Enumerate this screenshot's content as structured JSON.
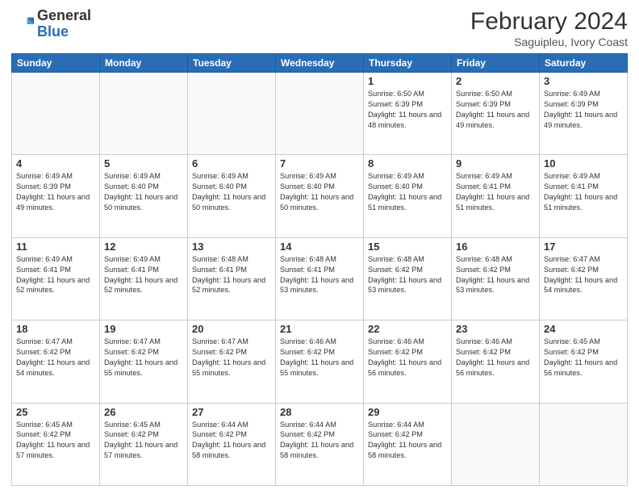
{
  "header": {
    "logo_general": "General",
    "logo_blue": "Blue",
    "month_title": "February 2024",
    "location": "Saguipleu, Ivory Coast"
  },
  "weekdays": [
    "Sunday",
    "Monday",
    "Tuesday",
    "Wednesday",
    "Thursday",
    "Friday",
    "Saturday"
  ],
  "weeks": [
    [
      {
        "day": "",
        "info": ""
      },
      {
        "day": "",
        "info": ""
      },
      {
        "day": "",
        "info": ""
      },
      {
        "day": "",
        "info": ""
      },
      {
        "day": "1",
        "info": "Sunrise: 6:50 AM\nSunset: 6:39 PM\nDaylight: 11 hours and 48 minutes."
      },
      {
        "day": "2",
        "info": "Sunrise: 6:50 AM\nSunset: 6:39 PM\nDaylight: 11 hours and 49 minutes."
      },
      {
        "day": "3",
        "info": "Sunrise: 6:49 AM\nSunset: 6:39 PM\nDaylight: 11 hours and 49 minutes."
      }
    ],
    [
      {
        "day": "4",
        "info": "Sunrise: 6:49 AM\nSunset: 6:39 PM\nDaylight: 11 hours and 49 minutes."
      },
      {
        "day": "5",
        "info": "Sunrise: 6:49 AM\nSunset: 6:40 PM\nDaylight: 11 hours and 50 minutes."
      },
      {
        "day": "6",
        "info": "Sunrise: 6:49 AM\nSunset: 6:40 PM\nDaylight: 11 hours and 50 minutes."
      },
      {
        "day": "7",
        "info": "Sunrise: 6:49 AM\nSunset: 6:40 PM\nDaylight: 11 hours and 50 minutes."
      },
      {
        "day": "8",
        "info": "Sunrise: 6:49 AM\nSunset: 6:40 PM\nDaylight: 11 hours and 51 minutes."
      },
      {
        "day": "9",
        "info": "Sunrise: 6:49 AM\nSunset: 6:41 PM\nDaylight: 11 hours and 51 minutes."
      },
      {
        "day": "10",
        "info": "Sunrise: 6:49 AM\nSunset: 6:41 PM\nDaylight: 11 hours and 51 minutes."
      }
    ],
    [
      {
        "day": "11",
        "info": "Sunrise: 6:49 AM\nSunset: 6:41 PM\nDaylight: 11 hours and 52 minutes."
      },
      {
        "day": "12",
        "info": "Sunrise: 6:49 AM\nSunset: 6:41 PM\nDaylight: 11 hours and 52 minutes."
      },
      {
        "day": "13",
        "info": "Sunrise: 6:48 AM\nSunset: 6:41 PM\nDaylight: 11 hours and 52 minutes."
      },
      {
        "day": "14",
        "info": "Sunrise: 6:48 AM\nSunset: 6:41 PM\nDaylight: 11 hours and 53 minutes."
      },
      {
        "day": "15",
        "info": "Sunrise: 6:48 AM\nSunset: 6:42 PM\nDaylight: 11 hours and 53 minutes."
      },
      {
        "day": "16",
        "info": "Sunrise: 6:48 AM\nSunset: 6:42 PM\nDaylight: 11 hours and 53 minutes."
      },
      {
        "day": "17",
        "info": "Sunrise: 6:47 AM\nSunset: 6:42 PM\nDaylight: 11 hours and 54 minutes."
      }
    ],
    [
      {
        "day": "18",
        "info": "Sunrise: 6:47 AM\nSunset: 6:42 PM\nDaylight: 11 hours and 54 minutes."
      },
      {
        "day": "19",
        "info": "Sunrise: 6:47 AM\nSunset: 6:42 PM\nDaylight: 11 hours and 55 minutes."
      },
      {
        "day": "20",
        "info": "Sunrise: 6:47 AM\nSunset: 6:42 PM\nDaylight: 11 hours and 55 minutes."
      },
      {
        "day": "21",
        "info": "Sunrise: 6:46 AM\nSunset: 6:42 PM\nDaylight: 11 hours and 55 minutes."
      },
      {
        "day": "22",
        "info": "Sunrise: 6:46 AM\nSunset: 6:42 PM\nDaylight: 11 hours and 56 minutes."
      },
      {
        "day": "23",
        "info": "Sunrise: 6:46 AM\nSunset: 6:42 PM\nDaylight: 11 hours and 56 minutes."
      },
      {
        "day": "24",
        "info": "Sunrise: 6:45 AM\nSunset: 6:42 PM\nDaylight: 11 hours and 56 minutes."
      }
    ],
    [
      {
        "day": "25",
        "info": "Sunrise: 6:45 AM\nSunset: 6:42 PM\nDaylight: 11 hours and 57 minutes."
      },
      {
        "day": "26",
        "info": "Sunrise: 6:45 AM\nSunset: 6:42 PM\nDaylight: 11 hours and 57 minutes."
      },
      {
        "day": "27",
        "info": "Sunrise: 6:44 AM\nSunset: 6:42 PM\nDaylight: 11 hours and 58 minutes."
      },
      {
        "day": "28",
        "info": "Sunrise: 6:44 AM\nSunset: 6:42 PM\nDaylight: 11 hours and 58 minutes."
      },
      {
        "day": "29",
        "info": "Sunrise: 6:44 AM\nSunset: 6:42 PM\nDaylight: 11 hours and 58 minutes."
      },
      {
        "day": "",
        "info": ""
      },
      {
        "day": "",
        "info": ""
      }
    ]
  ]
}
